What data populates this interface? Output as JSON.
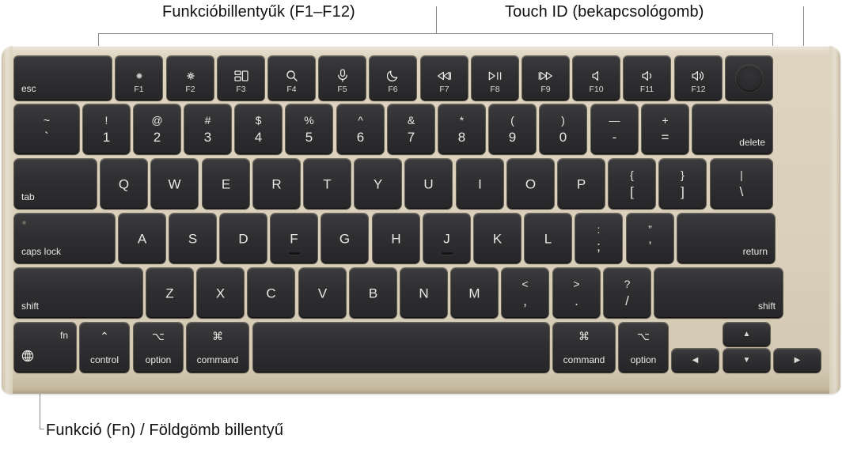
{
  "callouts": {
    "function_keys": "Funkcióbillentyűk (F1–F12)",
    "touch_id": "Touch ID (bekapcsológomb)",
    "fn_globe": "Funkció (Fn) / Földgömb billentyű"
  },
  "colors": {
    "chassis": "#d9cfba",
    "key_face": "#303032",
    "key_text": "#e9e7e2",
    "leader_line": "#8a8a8a",
    "label_text": "#111111"
  },
  "keyboard": {
    "layout": "Apple Magic Keyboard (US ANSI) with Touch ID",
    "function_row": [
      {
        "id": "esc",
        "label": "esc",
        "icon": null,
        "fkey": null,
        "units": 2.0
      },
      {
        "id": "f1",
        "label": null,
        "icon": "brightness-down-icon",
        "fkey": "F1",
        "units": 1.0
      },
      {
        "id": "f2",
        "label": null,
        "icon": "brightness-up-icon",
        "fkey": "F2",
        "units": 1.0
      },
      {
        "id": "f3",
        "label": null,
        "icon": "mission-control-icon",
        "fkey": "F3",
        "units": 1.0
      },
      {
        "id": "f4",
        "label": null,
        "icon": "search-icon",
        "fkey": "F4",
        "units": 1.0
      },
      {
        "id": "f5",
        "label": null,
        "icon": "dictation-mic-icon",
        "fkey": "F5",
        "units": 1.0
      },
      {
        "id": "f6",
        "label": null,
        "icon": "do-not-disturb-moon-icon",
        "fkey": "F6",
        "units": 1.0
      },
      {
        "id": "f7",
        "label": null,
        "icon": "rewind-icon",
        "fkey": "F7",
        "units": 1.0
      },
      {
        "id": "f8",
        "label": null,
        "icon": "play-pause-icon",
        "fkey": "F8",
        "units": 1.0
      },
      {
        "id": "f9",
        "label": null,
        "icon": "fast-forward-icon",
        "fkey": "F9",
        "units": 1.0
      },
      {
        "id": "f10",
        "label": null,
        "icon": "mute-icon",
        "fkey": "F10",
        "units": 1.0
      },
      {
        "id": "f11",
        "label": null,
        "icon": "volume-down-icon",
        "fkey": "F11",
        "units": 1.0
      },
      {
        "id": "f12",
        "label": null,
        "icon": "volume-up-icon",
        "fkey": "F12",
        "units": 1.0
      },
      {
        "id": "touchid",
        "label": null,
        "icon": "touch-id-icon",
        "fkey": null,
        "units": 1.0
      }
    ],
    "number_row": [
      {
        "id": "grave",
        "upper": "~",
        "lower": "`",
        "units": 1.35
      },
      {
        "id": "1",
        "upper": "!",
        "lower": "1",
        "units": 1.0
      },
      {
        "id": "2",
        "upper": "@",
        "lower": "2",
        "units": 1.0
      },
      {
        "id": "3",
        "upper": "#",
        "lower": "3",
        "units": 1.0
      },
      {
        "id": "4",
        "upper": "$",
        "lower": "4",
        "units": 1.0
      },
      {
        "id": "5",
        "upper": "%",
        "lower": "5",
        "units": 1.0
      },
      {
        "id": "6",
        "upper": "^",
        "lower": "6",
        "units": 1.0
      },
      {
        "id": "7",
        "upper": "&",
        "lower": "7",
        "units": 1.0
      },
      {
        "id": "8",
        "upper": "*",
        "lower": "8",
        "units": 1.0
      },
      {
        "id": "9",
        "upper": "(",
        "lower": "9",
        "units": 1.0
      },
      {
        "id": "0",
        "upper": ")",
        "lower": "0",
        "units": 1.0
      },
      {
        "id": "minus",
        "upper": "—",
        "lower": "-",
        "units": 1.0
      },
      {
        "id": "equal",
        "upper": "+",
        "lower": "=",
        "units": 1.0
      },
      {
        "id": "delete",
        "label": "delete",
        "units": 1.65
      }
    ],
    "top_row": [
      {
        "id": "tab",
        "label": "tab",
        "units": 1.7
      },
      {
        "id": "q",
        "center": "Q",
        "units": 1.0
      },
      {
        "id": "w",
        "center": "W",
        "units": 1.0
      },
      {
        "id": "e",
        "center": "E",
        "units": 1.0
      },
      {
        "id": "r",
        "center": "R",
        "units": 1.0
      },
      {
        "id": "t",
        "center": "T",
        "units": 1.0
      },
      {
        "id": "y",
        "center": "Y",
        "units": 1.0
      },
      {
        "id": "u",
        "center": "U",
        "units": 1.0
      },
      {
        "id": "i",
        "center": "I",
        "units": 1.0
      },
      {
        "id": "o",
        "center": "O",
        "units": 1.0
      },
      {
        "id": "p",
        "center": "P",
        "units": 1.0
      },
      {
        "id": "bracketleft",
        "upper": "{",
        "lower": "[",
        "units": 1.0
      },
      {
        "id": "bracketright",
        "upper": "}",
        "lower": "]",
        "units": 1.0
      },
      {
        "id": "backslash",
        "upper": "|",
        "lower": "\\",
        "units": 1.3
      }
    ],
    "home_row": [
      {
        "id": "capslock",
        "label": "caps lock",
        "led": true,
        "units": 2.05
      },
      {
        "id": "a",
        "center": "A",
        "units": 1.0
      },
      {
        "id": "s",
        "center": "S",
        "units": 1.0
      },
      {
        "id": "d",
        "center": "D",
        "units": 1.0
      },
      {
        "id": "f",
        "center": "F",
        "bump": true,
        "units": 1.0
      },
      {
        "id": "g",
        "center": "G",
        "units": 1.0
      },
      {
        "id": "h",
        "center": "H",
        "units": 1.0
      },
      {
        "id": "j",
        "center": "J",
        "bump": true,
        "units": 1.0
      },
      {
        "id": "k",
        "center": "K",
        "units": 1.0
      },
      {
        "id": "l",
        "center": "L",
        "units": 1.0
      },
      {
        "id": "semicolon",
        "upper": ":",
        "lower": ";",
        "units": 1.0
      },
      {
        "id": "quote",
        "upper": "”",
        "lower": "’",
        "units": 1.0
      },
      {
        "id": "return",
        "label": "return",
        "units": 2.0
      }
    ],
    "shift_row": [
      {
        "id": "shift-left",
        "label": "shift",
        "units": 2.6
      },
      {
        "id": "z",
        "center": "Z",
        "units": 1.0
      },
      {
        "id": "x",
        "center": "X",
        "units": 1.0
      },
      {
        "id": "c",
        "center": "C",
        "units": 1.0
      },
      {
        "id": "v",
        "center": "V",
        "units": 1.0
      },
      {
        "id": "b",
        "center": "B",
        "units": 1.0
      },
      {
        "id": "n",
        "center": "N",
        "units": 1.0
      },
      {
        "id": "m",
        "center": "M",
        "units": 1.0
      },
      {
        "id": "comma",
        "upper": "<",
        "lower": ",",
        "units": 1.0
      },
      {
        "id": "period",
        "upper": ">",
        "lower": ".",
        "units": 1.0
      },
      {
        "id": "slash",
        "upper": "?",
        "lower": "/",
        "units": 1.0
      },
      {
        "id": "shift-right",
        "label": "shift",
        "units": 2.6
      }
    ],
    "bottom_row": [
      {
        "id": "fn",
        "corner": "fn",
        "icon": "globe-icon",
        "units": 1.3
      },
      {
        "id": "control",
        "symbol": "⌃",
        "word": "control",
        "units": 1.05
      },
      {
        "id": "option-left",
        "symbol": "⌥",
        "word": "option",
        "units": 1.05
      },
      {
        "id": "command-left",
        "symbol": "⌘",
        "word": "command",
        "units": 1.3
      },
      {
        "id": "space",
        "units": 5.9
      },
      {
        "id": "command-right",
        "symbol": "⌘",
        "word": "command",
        "units": 1.3
      },
      {
        "id": "option-right",
        "symbol": "⌥",
        "word": "option",
        "units": 1.05
      }
    ],
    "arrow_cluster": [
      {
        "id": "arrow-left",
        "glyph": "◀",
        "name": "left-arrow-key"
      },
      {
        "id": "arrow-up",
        "glyph": "▲",
        "name": "up-arrow-key"
      },
      {
        "id": "arrow-down",
        "glyph": "▼",
        "name": "down-arrow-key"
      },
      {
        "id": "arrow-right",
        "glyph": "▶",
        "name": "right-arrow-key"
      }
    ]
  }
}
